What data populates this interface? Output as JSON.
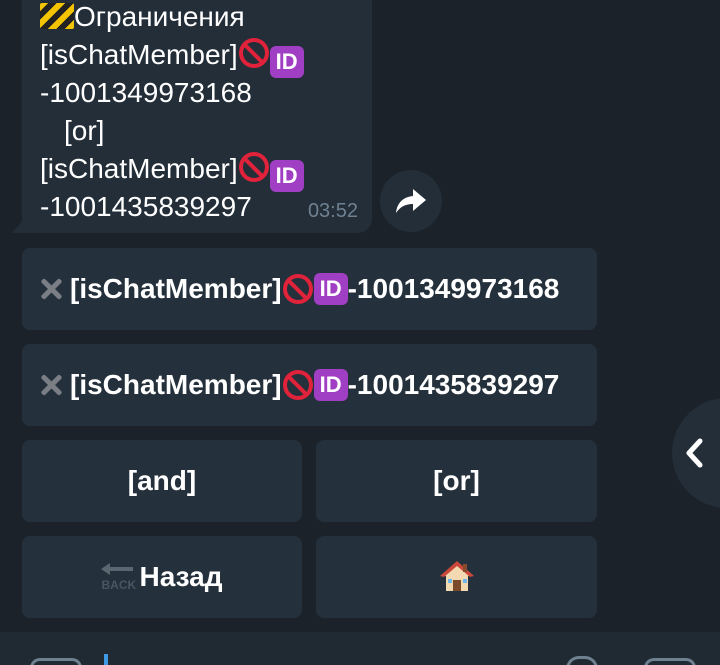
{
  "message": {
    "lines": [
      "Ограничения",
      "[isChatMember]",
      "-1001349973168",
      "[or]",
      "[isChatMember]",
      "-1001435839297"
    ],
    "time": "03:52",
    "icons": [
      "construction-icon",
      "no-entry-icon",
      "id-icon",
      "share-icon"
    ]
  },
  "keyboard": {
    "row1": "[isChatMember]",
    "row1_value": "-1001349973168",
    "row2": "[isChatMember]",
    "row2_value": "-1001435839297",
    "and_label": "[and]",
    "or_label": "[or]",
    "back_label": "Назад",
    "back_icon_text": "BACK",
    "home_icon": "house-icon"
  },
  "colors": {
    "background": "#1b2229",
    "bubble": "#232e39",
    "button": "#24303b",
    "time": "#6f8191",
    "accent": "#3f9ae6"
  }
}
